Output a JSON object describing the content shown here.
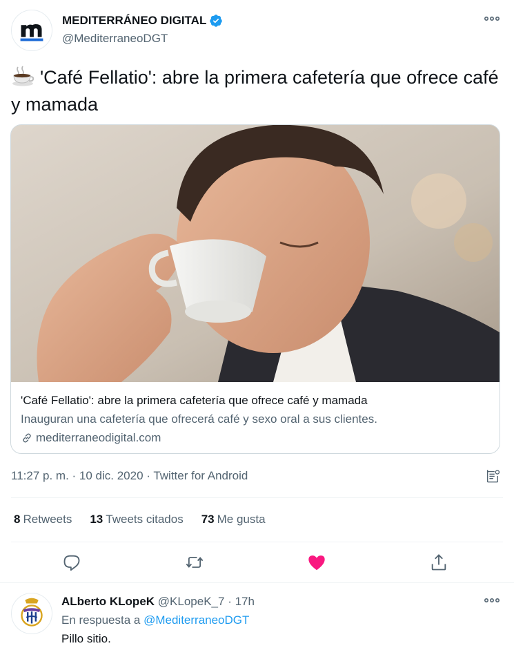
{
  "tweet": {
    "author_name": "MEDITERRÁNEO DIGITAL",
    "author_handle": "@MediterraneoDGT",
    "text": "'Café Fellatio': abre la primera cafetería que ofrece café y mamada",
    "emoji": "hot-beverage-icon",
    "card": {
      "title": "'Café Fellatio': abre la primera cafetería que ofrece café y mamada",
      "description": "Inauguran una cafetería que ofrecerá café y sexo oral a sus clientes.",
      "domain": "mediterraneodigital.com"
    },
    "meta": "11:27 p. m. · 10 dic. 2020 · Twitter for Android",
    "stats": {
      "retweets_count": "8",
      "retweets_label": "Retweets",
      "quotes_count": "13",
      "quotes_label": "Tweets citados",
      "likes_count": "73",
      "likes_label": "Me gusta"
    },
    "liked": true
  },
  "reply": {
    "author_name": "ALberto KLopeK",
    "author_handle": "@KLopeK_7",
    "separator": "·",
    "time": "17h",
    "reply_prefix": "En respuesta a",
    "reply_to": "@MediterraneoDGT",
    "text": "Pillo sitio."
  },
  "colors": {
    "accent": "#1d9bf0",
    "like": "#f91880",
    "text_secondary": "#536471",
    "brand_blue": "#1e6bd6"
  }
}
